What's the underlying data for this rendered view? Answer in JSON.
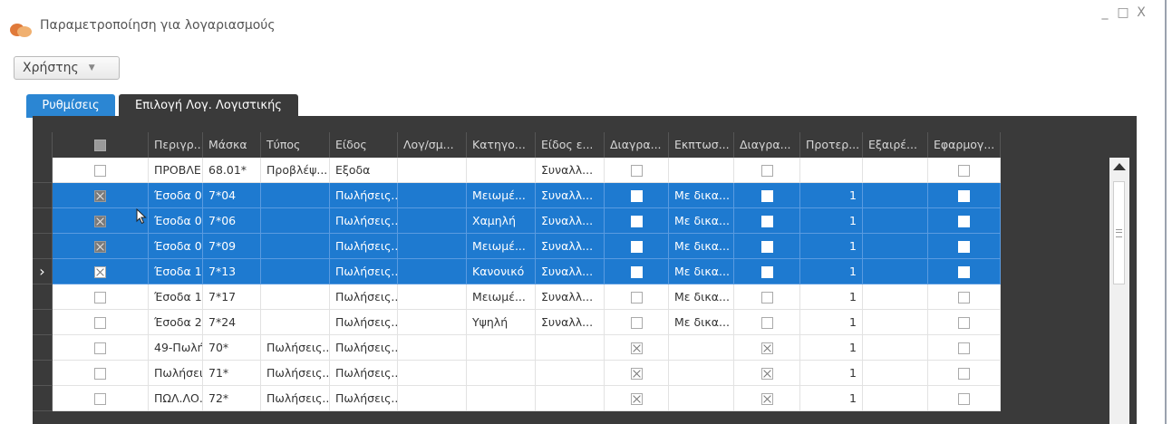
{
  "window": {
    "title": "Παραμετροποίηση για λογαριασμούς",
    "controls": [
      "_",
      "□",
      "X"
    ]
  },
  "user_dropdown": {
    "value": "Χρήστης",
    "caret": "▼"
  },
  "tabs": [
    {
      "label": "Ρυθμίσεις",
      "active": true
    },
    {
      "label": "Επιλογή Λογ. Λογιστικής",
      "active": false
    }
  ],
  "grid": {
    "columns": [
      "",
      "Περιγρ...",
      "Μάσκα",
      "Τύπος",
      "Είδος",
      "Λογ/σμ...",
      "Κατηγο...",
      "Είδος ε...",
      "Διαγρα...",
      "Εκπτωσ...",
      "Διαγρα...",
      "Προτερ...",
      "Εξαιρέ...",
      "Εφαρμογ..."
    ],
    "rows": [
      {
        "selected": false,
        "current": false,
        "check": "empty",
        "desc": "ΠΡΟΒΛΕ...",
        "mask": "68.01*",
        "type": "Προβλέψ...",
        "kind": "Εξοδα",
        "acc": "",
        "cat": "",
        "kind2": "Συναλλ...",
        "del1": "empty",
        "disc": "",
        "del2": "empty",
        "prio": "",
        "excl": "",
        "apply": "empty"
      },
      {
        "selected": true,
        "current": false,
        "check": "x",
        "desc": "Έσοδα 0...",
        "mask": "7*04",
        "type": "",
        "kind": "Πωλήσεις...",
        "acc": "",
        "cat": "Μειωμέ...",
        "kind2": "Συναλλ...",
        "del1": "white",
        "disc": "Με δικα...",
        "del2": "white",
        "prio": "1",
        "excl": "",
        "apply": "white"
      },
      {
        "selected": true,
        "current": false,
        "check": "x",
        "desc": "Έσοδα 0...",
        "mask": "7*06",
        "type": "",
        "kind": "Πωλήσεις...",
        "acc": "",
        "cat": "Χαμηλή",
        "kind2": "Συναλλ...",
        "del1": "white",
        "disc": "Με δικα...",
        "del2": "white",
        "prio": "1",
        "excl": "",
        "apply": "white"
      },
      {
        "selected": true,
        "current": false,
        "check": "x",
        "desc": "Έσοδα 0...",
        "mask": "7*09",
        "type": "",
        "kind": "Πωλήσεις...",
        "acc": "",
        "cat": "Μειωμέ...",
        "kind2": "Συναλλ...",
        "del1": "white",
        "disc": "Με δικα...",
        "del2": "white",
        "prio": "1",
        "excl": "",
        "apply": "white"
      },
      {
        "selected": true,
        "current": true,
        "check": "x-light",
        "desc": "Έσοδα 1...",
        "mask": "7*13",
        "type": "",
        "kind": "Πωλήσεις...",
        "acc": "",
        "cat": "Κανονικό",
        "kind2": "Συναλλ...",
        "del1": "white",
        "disc": "Με δικα...",
        "del2": "white",
        "prio": "1",
        "excl": "",
        "apply": "white"
      },
      {
        "selected": false,
        "current": false,
        "check": "empty",
        "desc": "Έσοδα 1...",
        "mask": "7*17",
        "type": "",
        "kind": "Πωλήσεις...",
        "acc": "",
        "cat": "Μειωμέ...",
        "kind2": "Συναλλ...",
        "del1": "empty",
        "disc": "Με δικα...",
        "del2": "empty",
        "prio": "1",
        "excl": "",
        "apply": "empty"
      },
      {
        "selected": false,
        "current": false,
        "check": "empty",
        "desc": "Έσοδα 2...",
        "mask": "7*24",
        "type": "",
        "kind": "Πωλήσεις...",
        "acc": "",
        "cat": "Υψηλή",
        "kind2": "Συναλλ...",
        "del1": "empty",
        "disc": "Με δικα...",
        "del2": "empty",
        "prio": "1",
        "excl": "",
        "apply": "empty"
      },
      {
        "selected": false,
        "current": false,
        "check": "empty",
        "desc": "49-Πωλή...",
        "mask": "70*",
        "type": "Πωλήσεις...",
        "kind": "Πωλήσεις...",
        "acc": "",
        "cat": "",
        "kind2": "",
        "del1": "x",
        "disc": "",
        "del2": "x",
        "prio": "1",
        "excl": "",
        "apply": "empty"
      },
      {
        "selected": false,
        "current": false,
        "check": "empty",
        "desc": "Πωλήσει...",
        "mask": "71*",
        "type": "Πωλήσεις...",
        "kind": "Πωλήσεις...",
        "acc": "",
        "cat": "",
        "kind2": "",
        "del1": "x",
        "disc": "",
        "del2": "x",
        "prio": "1",
        "excl": "",
        "apply": "empty"
      },
      {
        "selected": false,
        "current": false,
        "check": "empty",
        "desc": "ΠΩΛ.ΛΟ...",
        "mask": "72*",
        "type": "Πωλήσεις...",
        "kind": "Πωλήσεις...",
        "acc": "",
        "cat": "",
        "kind2": "",
        "del1": "x",
        "disc": "",
        "del2": "x",
        "prio": "1",
        "excl": "",
        "apply": "empty"
      }
    ]
  },
  "colors": {
    "accent": "#1e7ad0",
    "tab_active": "#2b86d3",
    "header_bg": "#3a3a3a"
  },
  "icons": {
    "app": "app-logo-icon",
    "cursor": "mouse-pointer-icon",
    "current_row": "row-indicator-arrow-icon"
  }
}
